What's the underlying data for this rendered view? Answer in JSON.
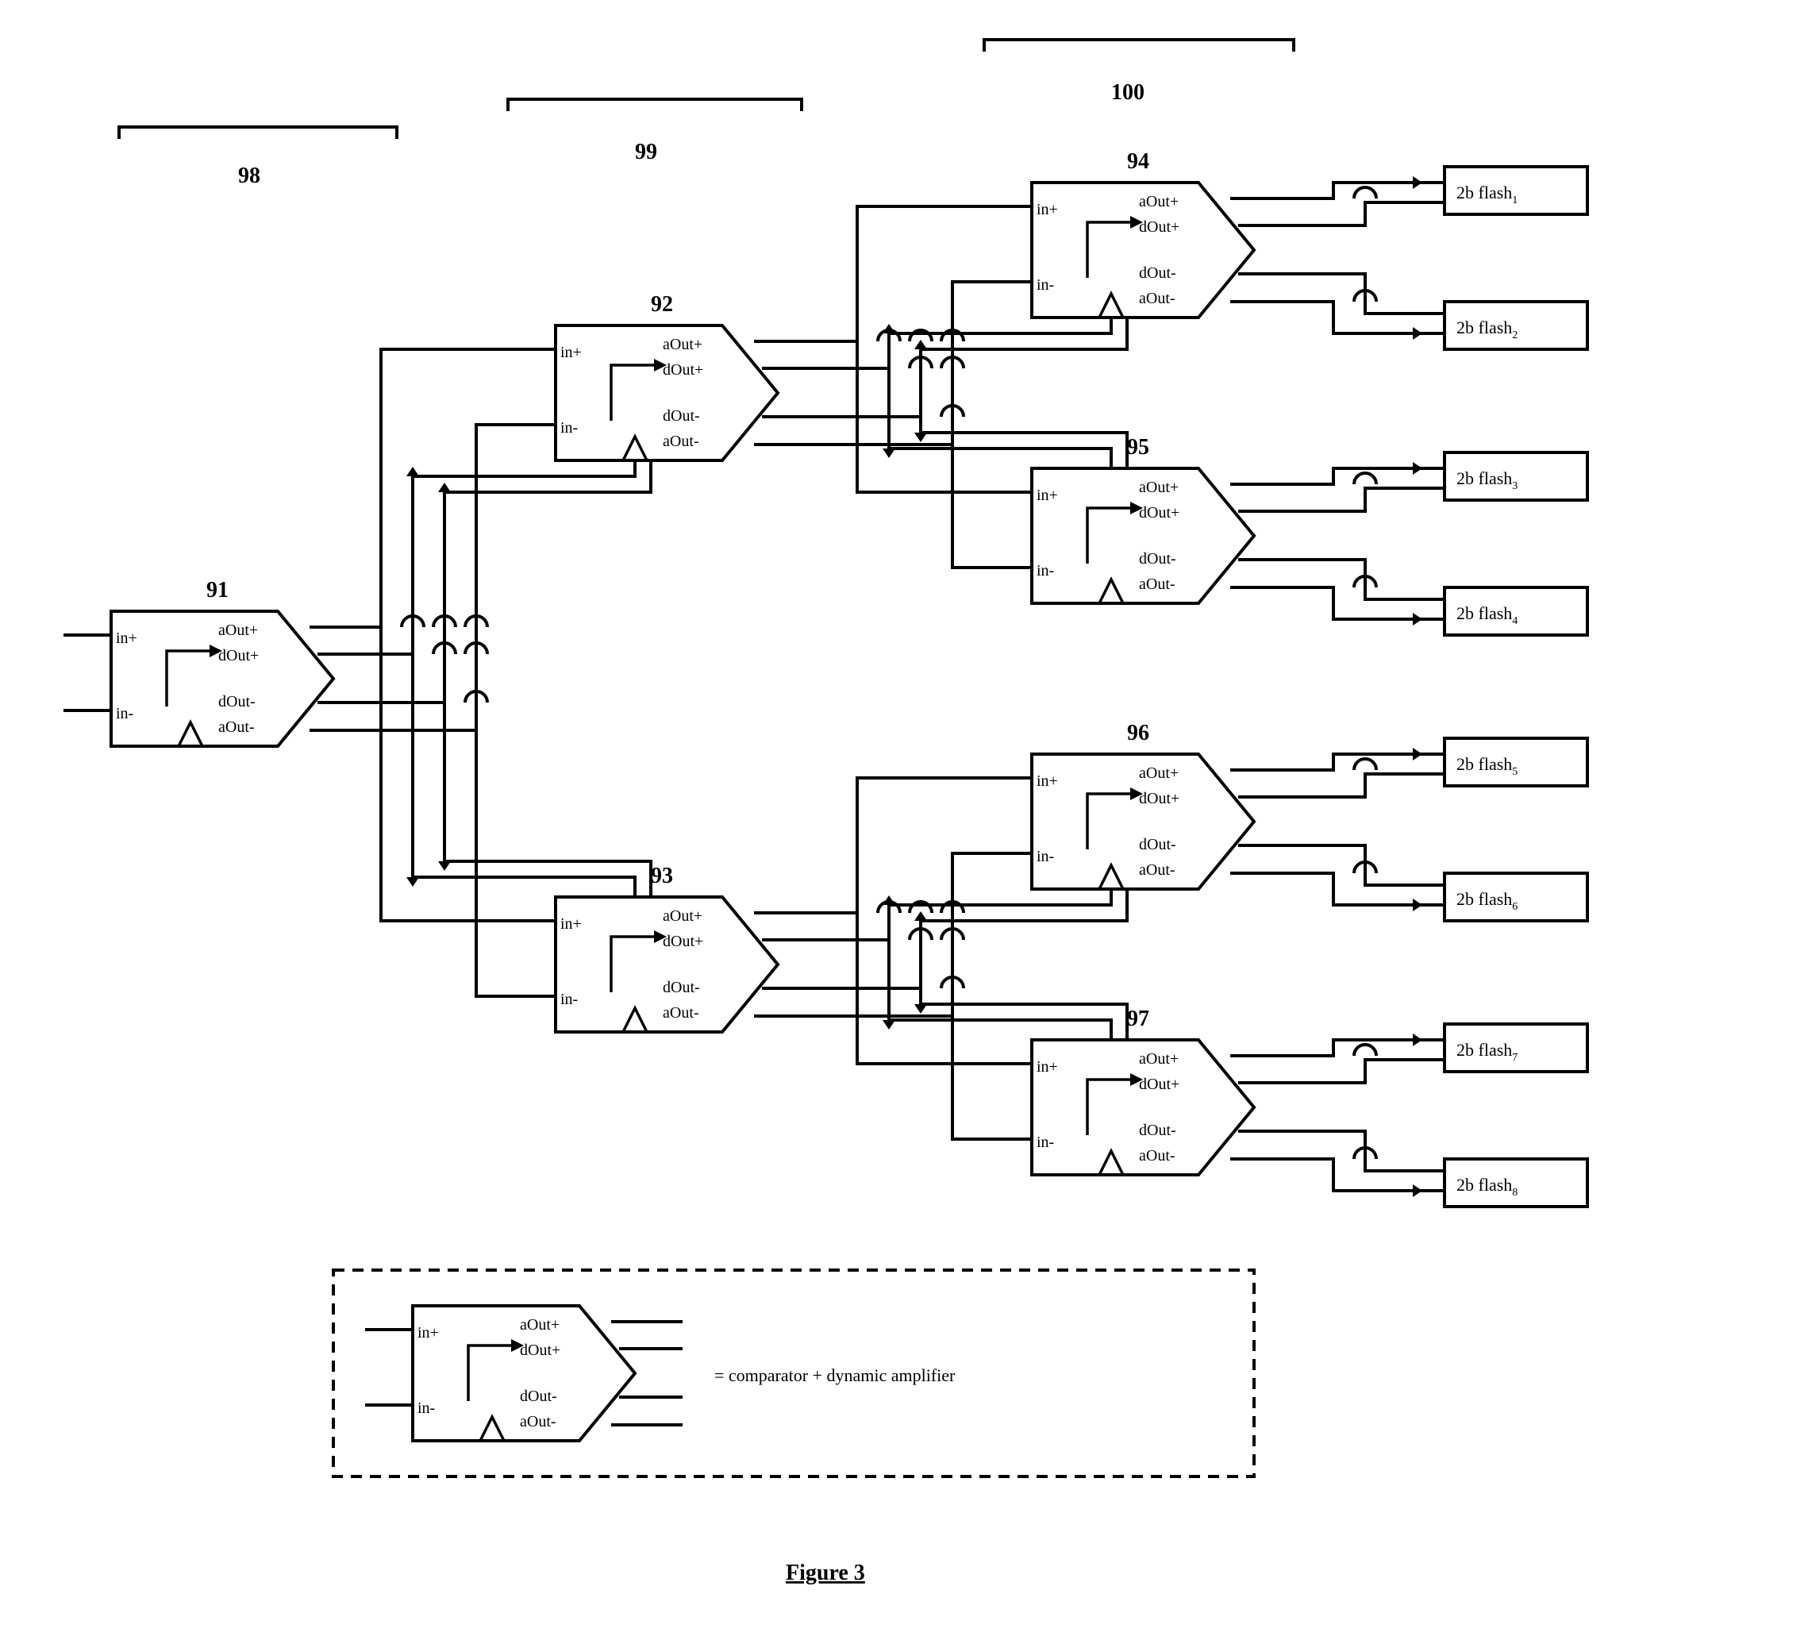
{
  "figure_label": "Figure 3",
  "stage_labels": {
    "s1": "98",
    "s2": "99",
    "s3": "100"
  },
  "block_numbers": {
    "b91": "91",
    "b92": "92",
    "b93": "93",
    "b94": "94",
    "b95": "95",
    "b96": "96",
    "b97": "97"
  },
  "port_labels": {
    "in_p": "in+",
    "in_m": "in-",
    "aOut_p": "aOut+",
    "dOut_p": "dOut+",
    "dOut_m": "dOut-",
    "aOut_m": "aOut-"
  },
  "flash_prefix": "2b flash",
  "flash_sub": {
    "f1": "1",
    "f2": "2",
    "f3": "3",
    "f4": "4",
    "f5": "5",
    "f6": "6",
    "f7": "7",
    "f8": "8"
  },
  "legend": "= comparator + dynamic amplifier"
}
